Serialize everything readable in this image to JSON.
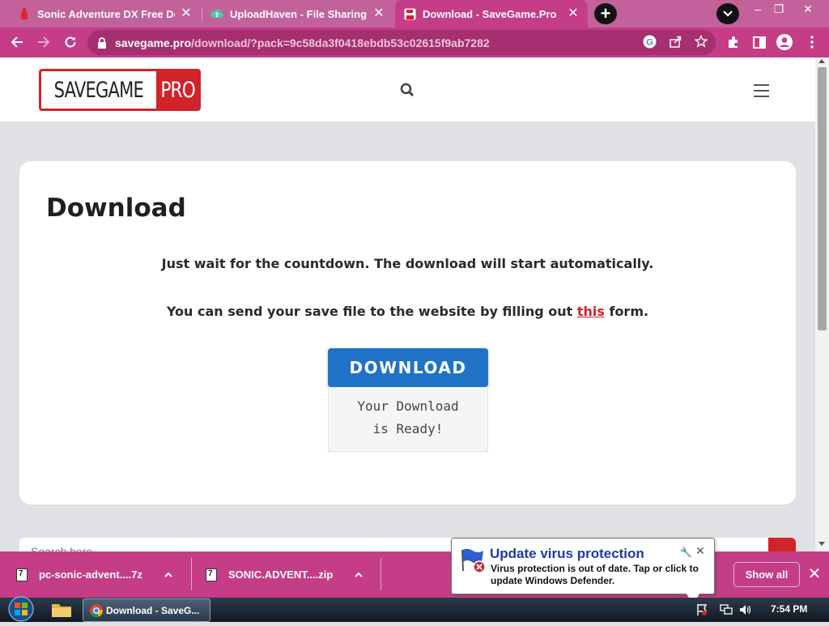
{
  "browser": {
    "tabs": [
      {
        "title": "Sonic Adventure DX Free Dow",
        "favicon": "red-game-icon",
        "active": false
      },
      {
        "title": "UploadHaven - File Sharing M",
        "favicon": "cloud-upload-icon",
        "active": false
      },
      {
        "title": "Download - SaveGame.Pro",
        "favicon": "floppy-disk-icon",
        "active": true
      }
    ],
    "new_tab_label": "+",
    "url_host": "savegame.pro",
    "url_path": "/download/?pack=9c58da3f0418ebdb53c02615f9ab7282"
  },
  "site": {
    "logo_left": "SAVEGAME",
    "logo_right": "PRO"
  },
  "card": {
    "heading": "Download",
    "wait_message": "Just wait for the countdown. The download will start automatically.",
    "send_prefix": "You can send your save file to the website by filling out ",
    "send_link": "this",
    "send_suffix": " form.",
    "download_button": "DOWNLOAD",
    "ready_line1": "Your Download",
    "ready_line2": "is Ready!"
  },
  "searchbar": {
    "placeholder": "Search here..."
  },
  "downloads_shelf": {
    "items": [
      {
        "name": "pc-sonic-advent....7z"
      },
      {
        "name": "SONIC.ADVENT....zip"
      }
    ],
    "show_all": "Show all"
  },
  "balloon": {
    "title": "Update virus protection",
    "body": "Virus protection is out of date. Tap or click to update Windows Defender."
  },
  "taskbar": {
    "chrome_window": "Download - SaveG...",
    "clock": "7:54 PM"
  },
  "colors": {
    "tab_bar": "#c2619a",
    "toolbar": "#c43d86",
    "brand_red": "#d0232a",
    "download_blue": "#1f72c6"
  }
}
